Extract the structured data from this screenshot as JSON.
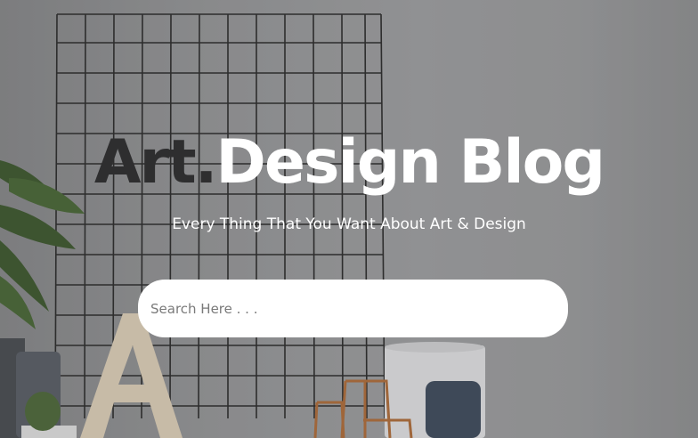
{
  "hero": {
    "title_part1": "Art.",
    "title_part2": "Design Blog",
    "subtitle": "Every Thing That You Want About Art & Design"
  },
  "search": {
    "placeholder": "Search Here . . .",
    "value": ""
  },
  "colors": {
    "title_dark": "#2e2e2f",
    "title_light": "#ffffff",
    "search_bg": "#ffffff"
  }
}
